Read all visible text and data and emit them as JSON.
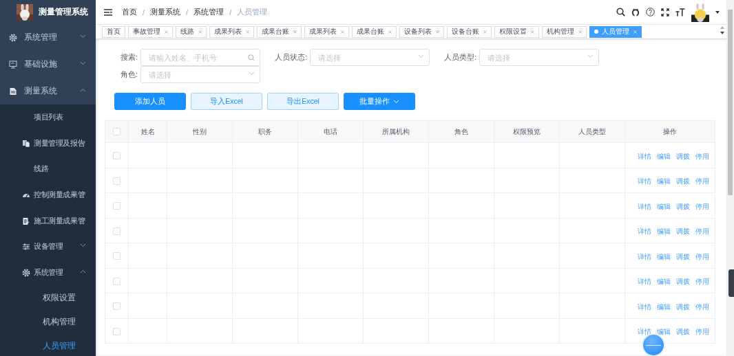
{
  "sidebar": {
    "title": "测量管理系统",
    "items": [
      {
        "label": "系统管理",
        "kind": "submenu",
        "expanded": false,
        "selected": false
      },
      {
        "label": "基础设施",
        "kind": "submenu",
        "expanded": false,
        "selected": false
      },
      {
        "label": "测量系统",
        "kind": "submenu",
        "expanded": true,
        "selected": false,
        "children": [
          {
            "label": "项目列表",
            "kind": "leaf",
            "selected": false
          },
          {
            "label": "测量管理及报告",
            "kind": "submenu",
            "expanded": false,
            "selected": false
          },
          {
            "label": "线路",
            "kind": "leaf",
            "selected": false
          },
          {
            "label": "控制测量成果管",
            "kind": "submenu",
            "expanded": false,
            "selected": false
          },
          {
            "label": "施工测量成果管",
            "kind": "submenu",
            "expanded": false,
            "selected": false
          },
          {
            "label": "设备管理",
            "kind": "submenu",
            "expanded": false,
            "selected": false
          },
          {
            "label": "系统管理",
            "kind": "submenu",
            "expanded": true,
            "selected": false,
            "children": [
              {
                "label": "权限设置",
                "kind": "leaf",
                "selected": false
              },
              {
                "label": "机构管理",
                "kind": "leaf",
                "selected": false
              },
              {
                "label": "人员管理",
                "kind": "leaf",
                "selected": true
              }
            ]
          }
        ]
      }
    ]
  },
  "breadcrumb": {
    "separator": "/",
    "items": [
      "首页",
      "测量系统",
      "系统管理",
      "人员管理"
    ]
  },
  "tags": [
    {
      "label": "首页",
      "closable": false,
      "selected": false
    },
    {
      "label": "事故管理",
      "closable": true,
      "selected": false
    },
    {
      "label": "线路",
      "closable": true,
      "selected": false
    },
    {
      "label": "成果列表",
      "closable": true,
      "selected": false
    },
    {
      "label": "成果台账",
      "closable": true,
      "selected": false
    },
    {
      "label": "成果列表",
      "closable": true,
      "selected": false
    },
    {
      "label": "成果台账",
      "closable": true,
      "selected": false
    },
    {
      "label": "设备列表",
      "closable": true,
      "selected": false
    },
    {
      "label": "设备台账",
      "closable": true,
      "selected": false
    },
    {
      "label": "权限设置",
      "closable": true,
      "selected": false
    },
    {
      "label": "机构管理",
      "closable": true,
      "selected": false
    },
    {
      "label": "人员管理",
      "closable": true,
      "selected": true
    }
  ],
  "filters": [
    {
      "label": "搜索:",
      "kind": "search",
      "placeholder": "请输入姓名、手机号"
    },
    {
      "label": "人员状态:",
      "kind": "select",
      "placeholder": "请选择"
    },
    {
      "label": "人员类型:",
      "kind": "select",
      "placeholder": "请选择"
    },
    {
      "label": "角色:",
      "kind": "select",
      "placeholder": "请选择"
    }
  ],
  "buttons": [
    {
      "label": "添加人员",
      "kind": "primary"
    },
    {
      "label": "导入Excel",
      "kind": "plain"
    },
    {
      "label": "导出Excel",
      "kind": "plain"
    },
    {
      "label": "批量操作",
      "kind": "dropdown"
    }
  ],
  "table": {
    "select_all_checked": false,
    "columns": [
      "姓名",
      "性别",
      "职务",
      "电话",
      "所属机构",
      "角色",
      "权限预览",
      "人员类型",
      "操作"
    ],
    "rows": [
      {
        "checked": false,
        "actions": [
          "详情",
          "编辑",
          "调拨",
          "停用"
        ]
      },
      {
        "checked": false,
        "actions": [
          "详情",
          "编辑",
          "调拨",
          "停用"
        ]
      },
      {
        "checked": false,
        "actions": [
          "详情",
          "编辑",
          "调拨",
          "停用"
        ]
      },
      {
        "checked": false,
        "actions": [
          "详情",
          "编辑",
          "调拨",
          "停用"
        ]
      },
      {
        "checked": false,
        "actions": [
          "详情",
          "编辑",
          "调拨",
          "停用"
        ]
      },
      {
        "checked": false,
        "actions": [
          "详情",
          "编辑",
          "调拨",
          "停用"
        ]
      },
      {
        "checked": false,
        "actions": [
          "详情",
          "编辑",
          "调拨",
          "停用"
        ]
      },
      {
        "checked": false,
        "actions": [
          "详情",
          "编辑",
          "调拨",
          "停用"
        ]
      }
    ]
  }
}
